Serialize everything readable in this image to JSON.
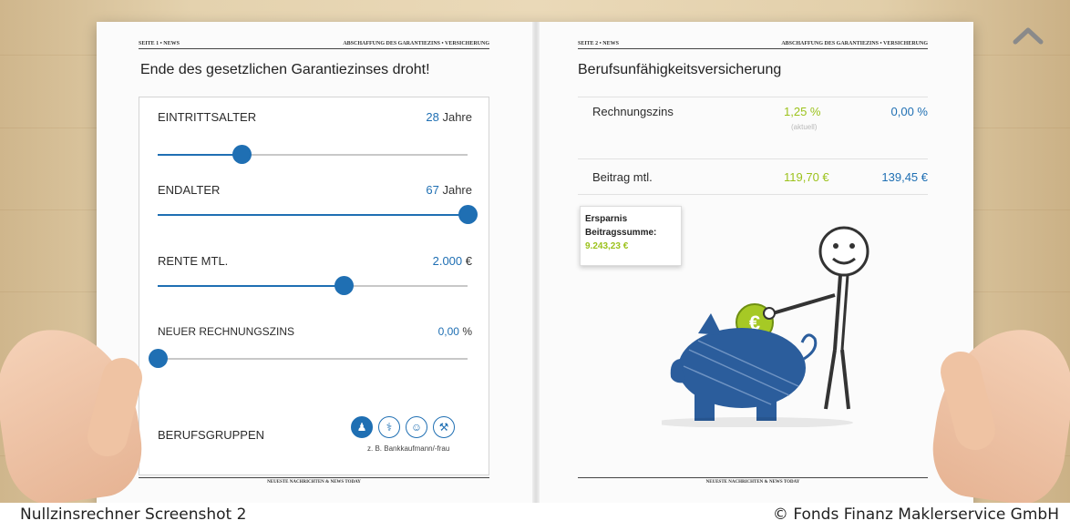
{
  "left_page": {
    "header_left": "SEITE 1 • NEWS",
    "header_right": "ABSCHAFFUNG DES GARANTIEZINS • VERSICHERUNG",
    "title": "Ende des gesetzlichen Garantiezinses droht!",
    "sliders": [
      {
        "label": "EINTRITTSALTER",
        "value": "28",
        "unit": " Jahre",
        "fraction": 0.27
      },
      {
        "label": "ENDALTER",
        "value": "67",
        "unit": " Jahre",
        "fraction": 1.0
      },
      {
        "label": "RENTE MTL.",
        "value": "2.000",
        "unit": " €",
        "fraction": 0.6
      },
      {
        "label": "NEUER RECHNUNGSZINS",
        "value": "0,00",
        "unit": " %",
        "fraction": 0.0
      }
    ],
    "groups_label": "BERUFSGRUPPEN",
    "group_icons": [
      "office-worker-icon",
      "doctor-icon",
      "nurse-icon",
      "craftsman-icon"
    ],
    "group_caption": "z. B. Bankkaufmann/-frau",
    "footer": "NEUESTE NACHRICHTEN   &   NEWS TODAY"
  },
  "right_page": {
    "header_left": "SEITE 2 • NEWS",
    "header_right": "ABSCHAFFUNG DES GARANTIEZINS • VERSICHERUNG",
    "title": "Berufsunfähigkeitsversicherung",
    "rows": [
      {
        "label": "Rechnungszins",
        "current": "1,25 %",
        "current_note": "(aktuell)",
        "new": "0,00 %"
      },
      {
        "label": "Beitrag mtl.",
        "current": "119,70 €",
        "new": "139,45 €"
      }
    ],
    "savings": {
      "line1": "Ersparnis",
      "line2": "Beitragssumme:",
      "value": "9.243,23 €"
    },
    "illustration_coin": "€",
    "footer": "NEUESTE NACHRICHTEN   &   NEWS TODAY"
  },
  "colors": {
    "accent_blue": "#1f6fb3",
    "accent_green": "#9cc21c"
  },
  "caption_left": "Nullzinsrechner Screenshot 2",
  "caption_right": "© Fonds Finanz Maklerservice GmbH"
}
